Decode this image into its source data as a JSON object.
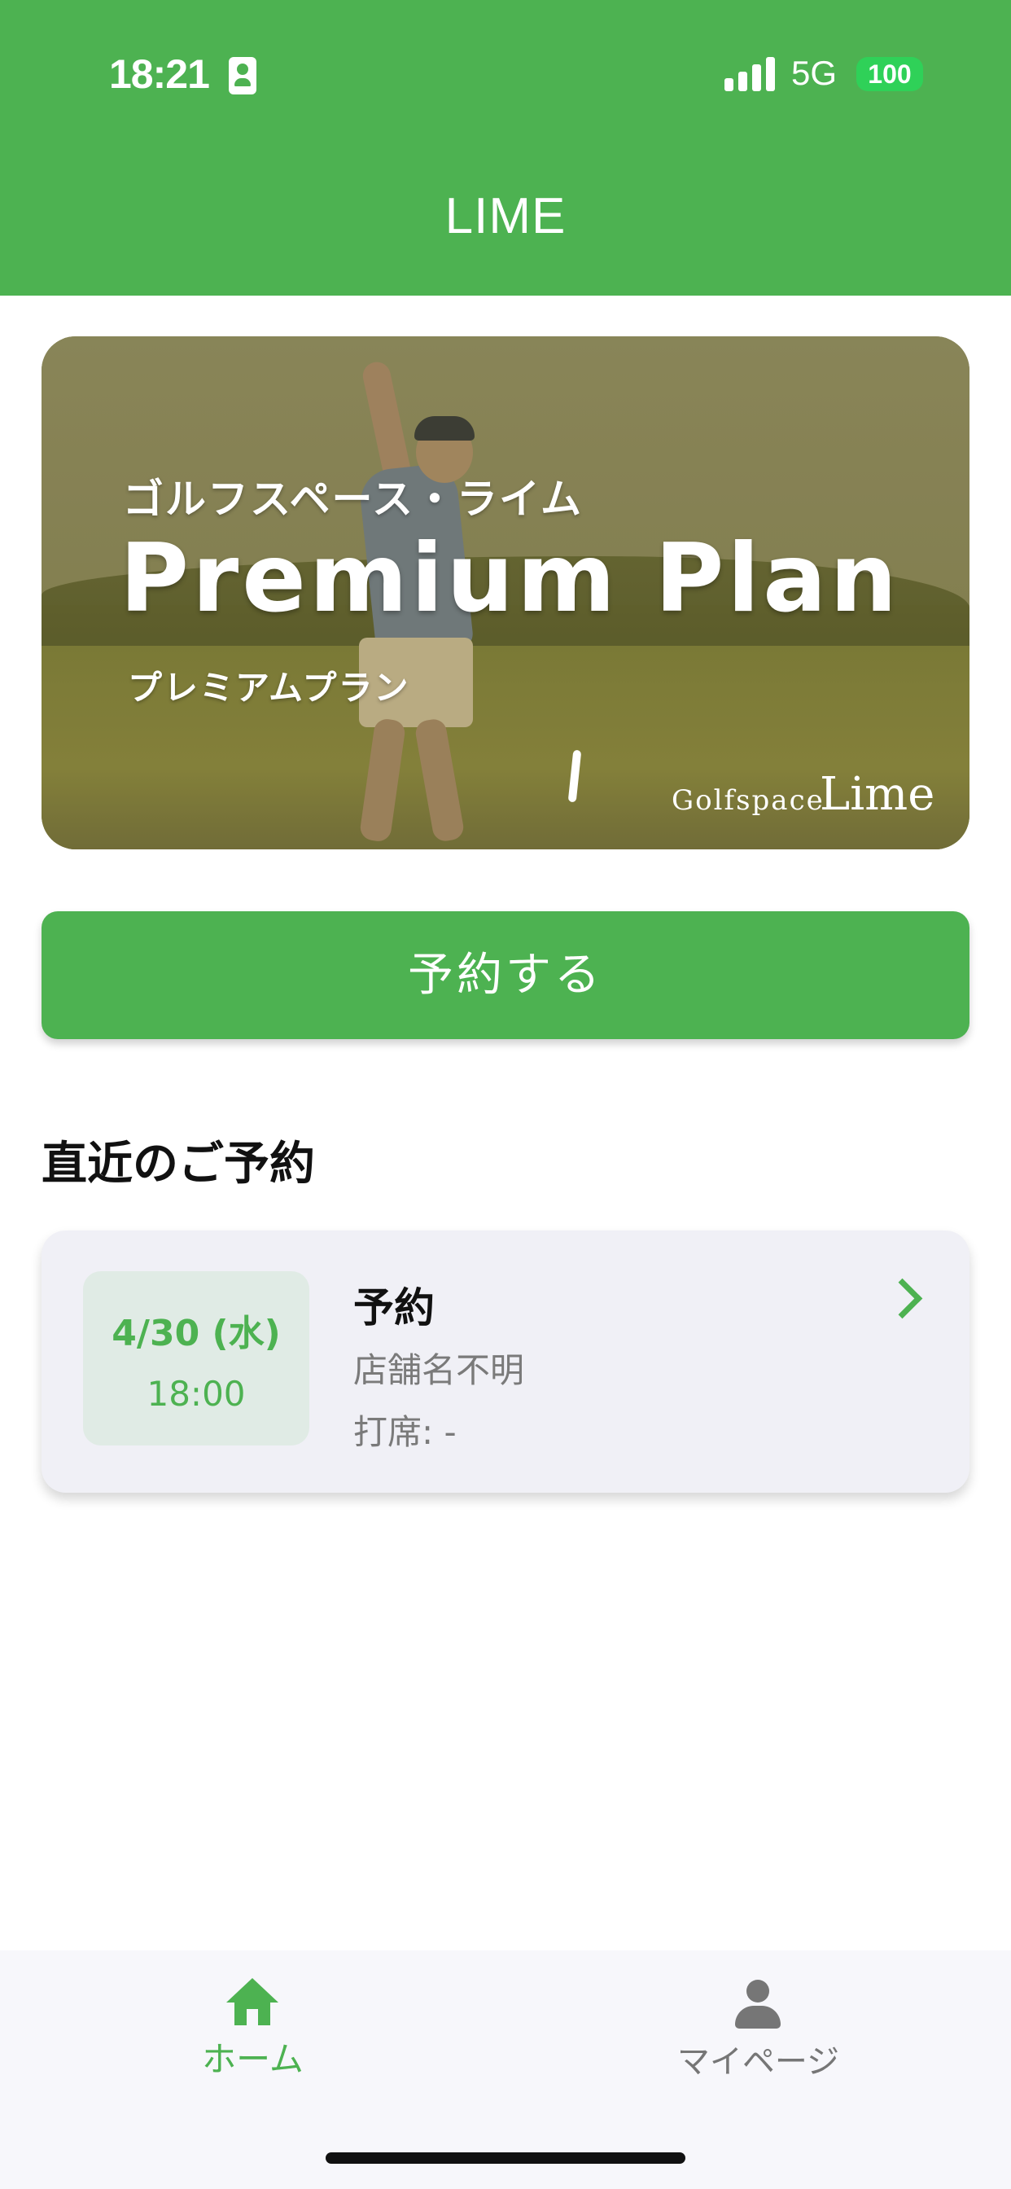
{
  "status_bar": {
    "time": "18:21",
    "network": "5G",
    "battery": "100",
    "battery_color": "#2fd158"
  },
  "header": {
    "title": "LIME",
    "background_color": "#4db251"
  },
  "banner": {
    "subtitle": "ゴルフスペース・ライム",
    "title": "Premium Plan",
    "caption": "プレミアムプラン",
    "logo_small": "Golfspace",
    "logo_big": "Lime"
  },
  "reserve_button": {
    "label": "予約する"
  },
  "recent": {
    "section_title": "直近のご予約",
    "reservations": [
      {
        "date": "4/30 (水)",
        "time": "18:00",
        "title": "予約",
        "store": "店舗名不明",
        "seat": "打席: -"
      }
    ]
  },
  "tabbar": {
    "home_label": "ホーム",
    "home_icon": "home-icon",
    "mypage_label": "マイページ",
    "mypage_icon": "person-icon",
    "active_color": "#4db251",
    "inactive_color": "#767676"
  }
}
